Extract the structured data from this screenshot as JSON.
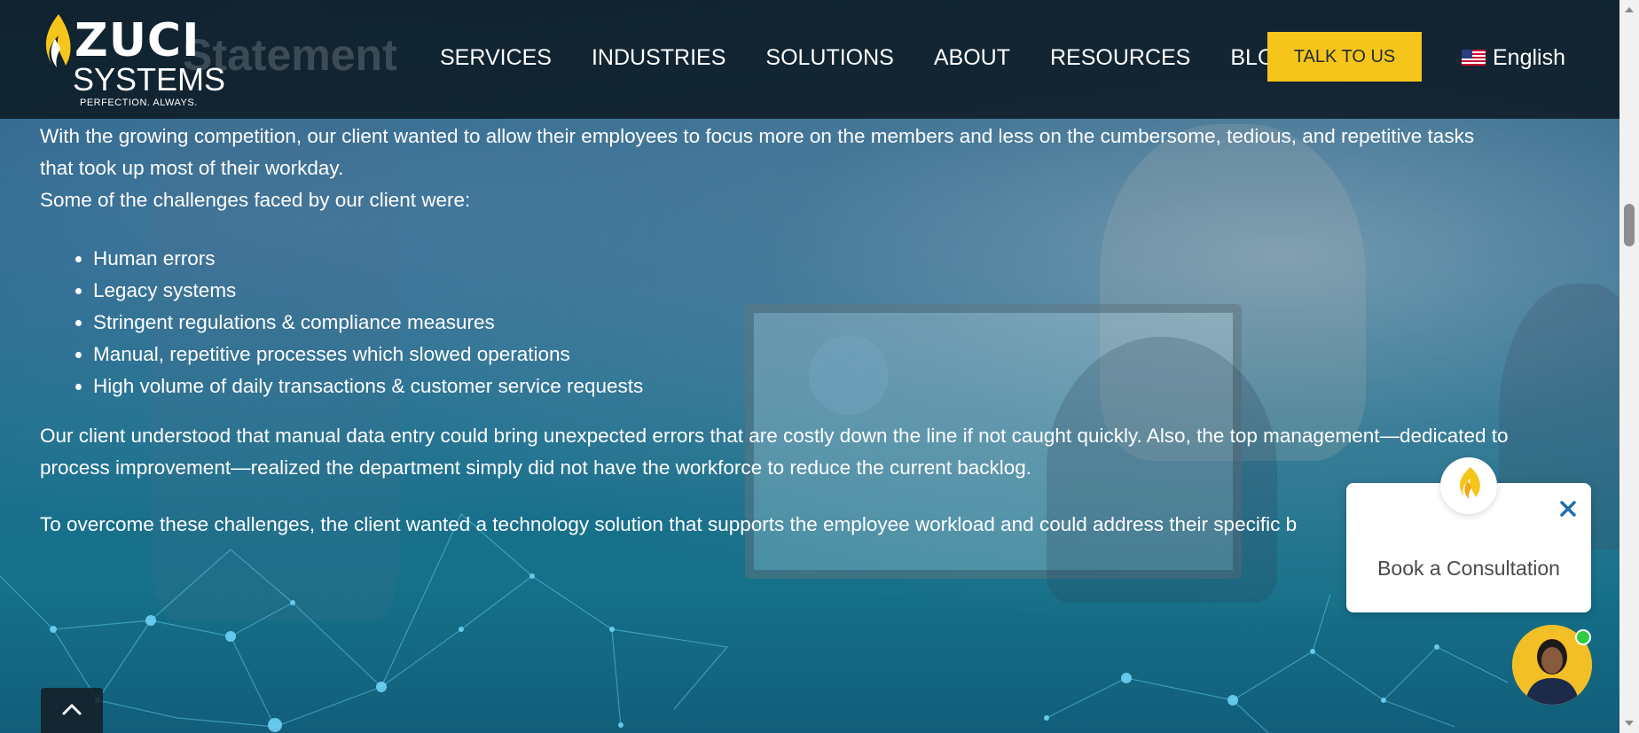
{
  "header": {
    "logo": {
      "brand": "ZUCI",
      "sub": "SYSTEMS",
      "tagline": "PERFECTION. ALWAYS."
    },
    "partial_heading": "Statement",
    "nav": [
      {
        "label": "SERVICES"
      },
      {
        "label": "INDUSTRIES"
      },
      {
        "label": "SOLUTIONS"
      },
      {
        "label": "ABOUT"
      },
      {
        "label": "RESOURCES"
      },
      {
        "label": "BLOG"
      }
    ],
    "cta_label": "TALK TO US",
    "language": {
      "label": "English",
      "flag_icon": "us-flag-icon"
    }
  },
  "content": {
    "paragraph1_line1": "With the growing competition, our client wanted to allow their employees to focus more on the members and less on the cumbersome, tedious, and repetitive tasks",
    "paragraph1_line2": "that took up most of their workday.",
    "challenges_intro": "Some of the challenges faced by our client were:",
    "challenges": [
      "Human errors",
      "Legacy systems",
      "Stringent regulations & compliance measures",
      "Manual, repetitive processes which slowed operations",
      "High volume of daily transactions & customer service requests"
    ],
    "paragraph2": "Our client understood that manual data entry could bring unexpected errors that are costly down the line if not caught quickly. Also, the top management—dedicated to process improvement—realized the department simply did not have the workforce to reduce the current backlog.",
    "paragraph3": "To overcome these challenges, the client wanted a technology solution that supports the employee workload and could address their specific b"
  },
  "chat_widget": {
    "label": "Book a Consultation",
    "close_icon": "close-icon"
  },
  "colors": {
    "accent_yellow": "#f6c51b",
    "header_bg": "#0c1822",
    "close_blue": "#1f6fb2"
  }
}
